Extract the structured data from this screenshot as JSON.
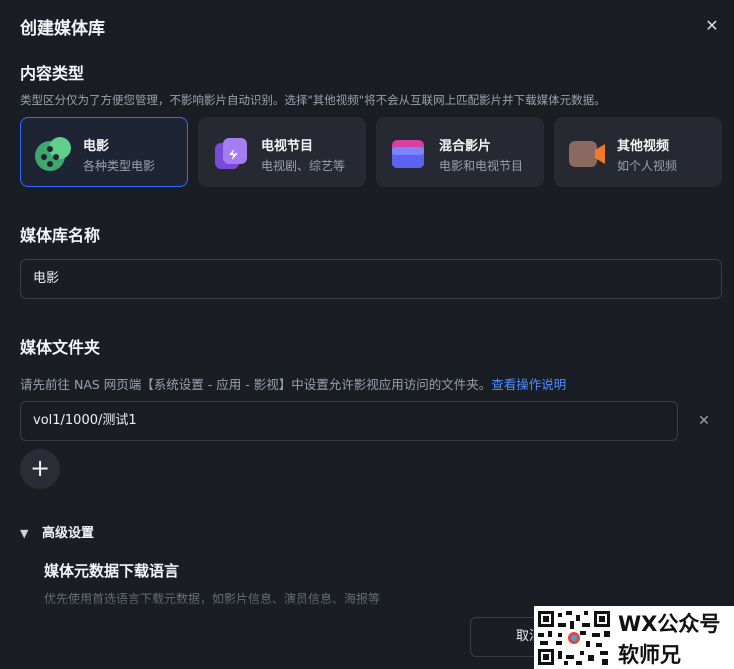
{
  "dialog": {
    "title": "创建媒体库",
    "close_icon": "close-icon"
  },
  "content_type": {
    "heading": "内容类型",
    "hint": "类型区分仅为了方便您管理，不影响影片自动识别。选择\"其他视频\"将不会从互联网上匹配影片并下载媒体元数据。",
    "types": [
      {
        "name": "电影",
        "desc": "各种类型电影",
        "icon": "film-reel-icon",
        "selected": true
      },
      {
        "name": "电视节目",
        "desc": "电视剧、综艺等",
        "icon": "tv-icon",
        "selected": false
      },
      {
        "name": "混合影片",
        "desc": "电影和电视节目",
        "icon": "folder-icon",
        "selected": false
      },
      {
        "name": "其他视频",
        "desc": "如个人视频",
        "icon": "video-camera-icon",
        "selected": false
      }
    ]
  },
  "library_name": {
    "heading": "媒体库名称",
    "value": "电影"
  },
  "media_folder": {
    "heading": "媒体文件夹",
    "hint": "请先前往 NAS 网页端【系统设置 - 应用 - 影视】中设置允许影视应用访问的文件夹。",
    "link": "查看操作说明",
    "folders": [
      "vol1/1000/测试1"
    ],
    "remove_icon": "close-icon",
    "add_icon": "plus-icon"
  },
  "advanced": {
    "label": "高级设置",
    "expanded": true,
    "metadata_lang_heading": "媒体元数据下载语言",
    "metadata_lang_hint": "优先使用首选语言下载元数据，如影片信息、演员信息、海报等"
  },
  "footer": {
    "cancel_label": "取消"
  },
  "watermark": {
    "line1": "WX公众号",
    "line2": "软师兄"
  },
  "colors": {
    "background": "#1b1d25",
    "card": "#262932",
    "accent": "#2d6bff",
    "link": "#4d8dff"
  }
}
